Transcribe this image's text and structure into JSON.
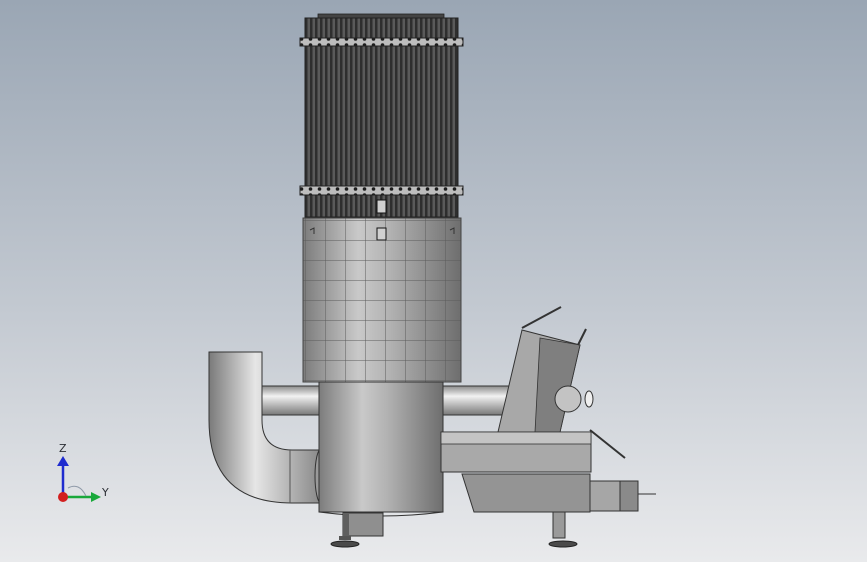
{
  "viewport": {
    "background_top": "#9aa6b4",
    "background_bottom": "#e9eaec"
  },
  "model": {
    "body_color": "#9e9e9e",
    "edge_color": "#2b2b2b",
    "cylinder_highlight": "#d9d9d9"
  },
  "triad": {
    "z_label": "Z",
    "y_label": "Y",
    "z_color": "#1f2ccf",
    "y_color": "#18a83a",
    "x_color": "#d21f1f"
  }
}
